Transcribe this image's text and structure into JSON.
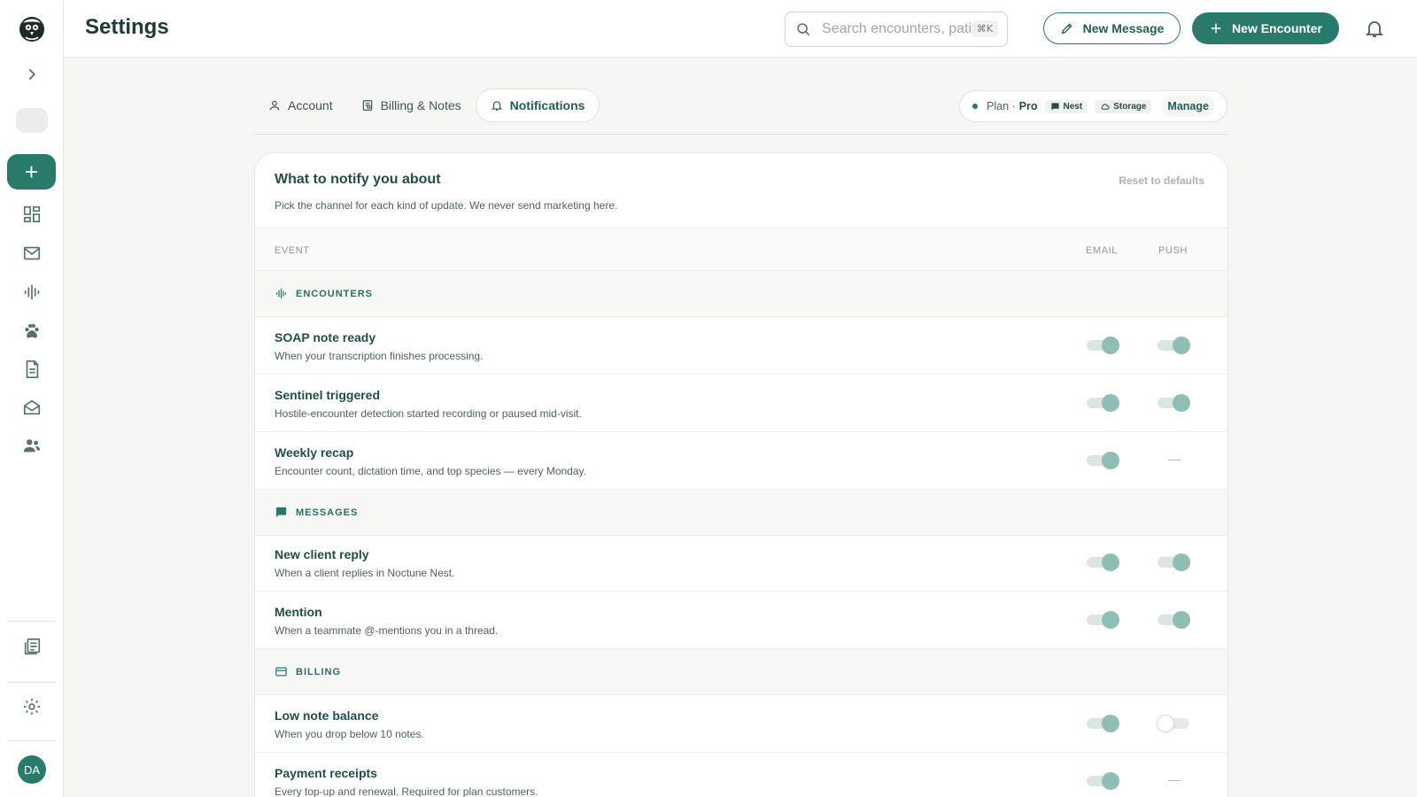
{
  "header": {
    "title": "Settings",
    "search_placeholder": "Search encounters, patients",
    "search_shortcut": "⌘K",
    "new_message_label": "New Message",
    "new_encounter_label": "New Encounter"
  },
  "sidebar": {
    "avatar_initials": "DA",
    "items": [
      "dashboard-icon",
      "mail-icon",
      "waveform-icon",
      "paw-icon",
      "document-icon",
      "inbox-icon",
      "team-icon",
      "notes-icon",
      "gear-icon"
    ]
  },
  "tabs": [
    {
      "label": "Account",
      "icon": "user-icon",
      "active": false
    },
    {
      "label": "Billing & Notes",
      "icon": "receipt-icon",
      "active": false
    },
    {
      "label": "Notifications",
      "icon": "bell-icon",
      "active": true
    }
  ],
  "plan": {
    "prefix": "Plan ·",
    "name": "Pro",
    "chip_nest": "Nest",
    "chip_storage": "Storage",
    "manage_label": "Manage"
  },
  "card": {
    "title": "What to notify you about",
    "subtitle": "Pick the channel for each kind of update. We never send marketing here.",
    "reset_label": "Reset to defaults",
    "col_event": "EVENT",
    "col_email": "EMAIL",
    "col_push": "PUSH"
  },
  "sections": [
    {
      "label": "ENCOUNTERS",
      "icon": "waveform-icon",
      "rows": [
        {
          "name": "SOAP note ready",
          "desc": "When your transcription finishes processing.",
          "email": true,
          "push": true
        },
        {
          "name": "Sentinel triggered",
          "desc": "Hostile-encounter detection started recording or paused mid-visit.",
          "email": true,
          "push": true
        },
        {
          "name": "Weekly recap",
          "desc": "Encounter count, dictation time, and top species — every Monday.",
          "email": true,
          "push": null
        }
      ]
    },
    {
      "label": "MESSAGES",
      "icon": "chat-icon",
      "rows": [
        {
          "name": "New client reply",
          "desc": "When a client replies in Noctune Nest.",
          "email": true,
          "push": true
        },
        {
          "name": "Mention",
          "desc": "When a teammate @-mentions you in a thread.",
          "email": true,
          "push": true
        }
      ]
    },
    {
      "label": "BILLING",
      "icon": "card-icon",
      "rows": [
        {
          "name": "Low note balance",
          "desc": "When you drop below 10 notes.",
          "email": true,
          "push": false
        },
        {
          "name": "Payment receipts",
          "desc": "Every top-up and renewal. Required for plan customers.",
          "email": true,
          "push": null
        }
      ]
    }
  ],
  "colors": {
    "accent": "#2a7a6b",
    "toggle_on": "#8fbfb4"
  }
}
